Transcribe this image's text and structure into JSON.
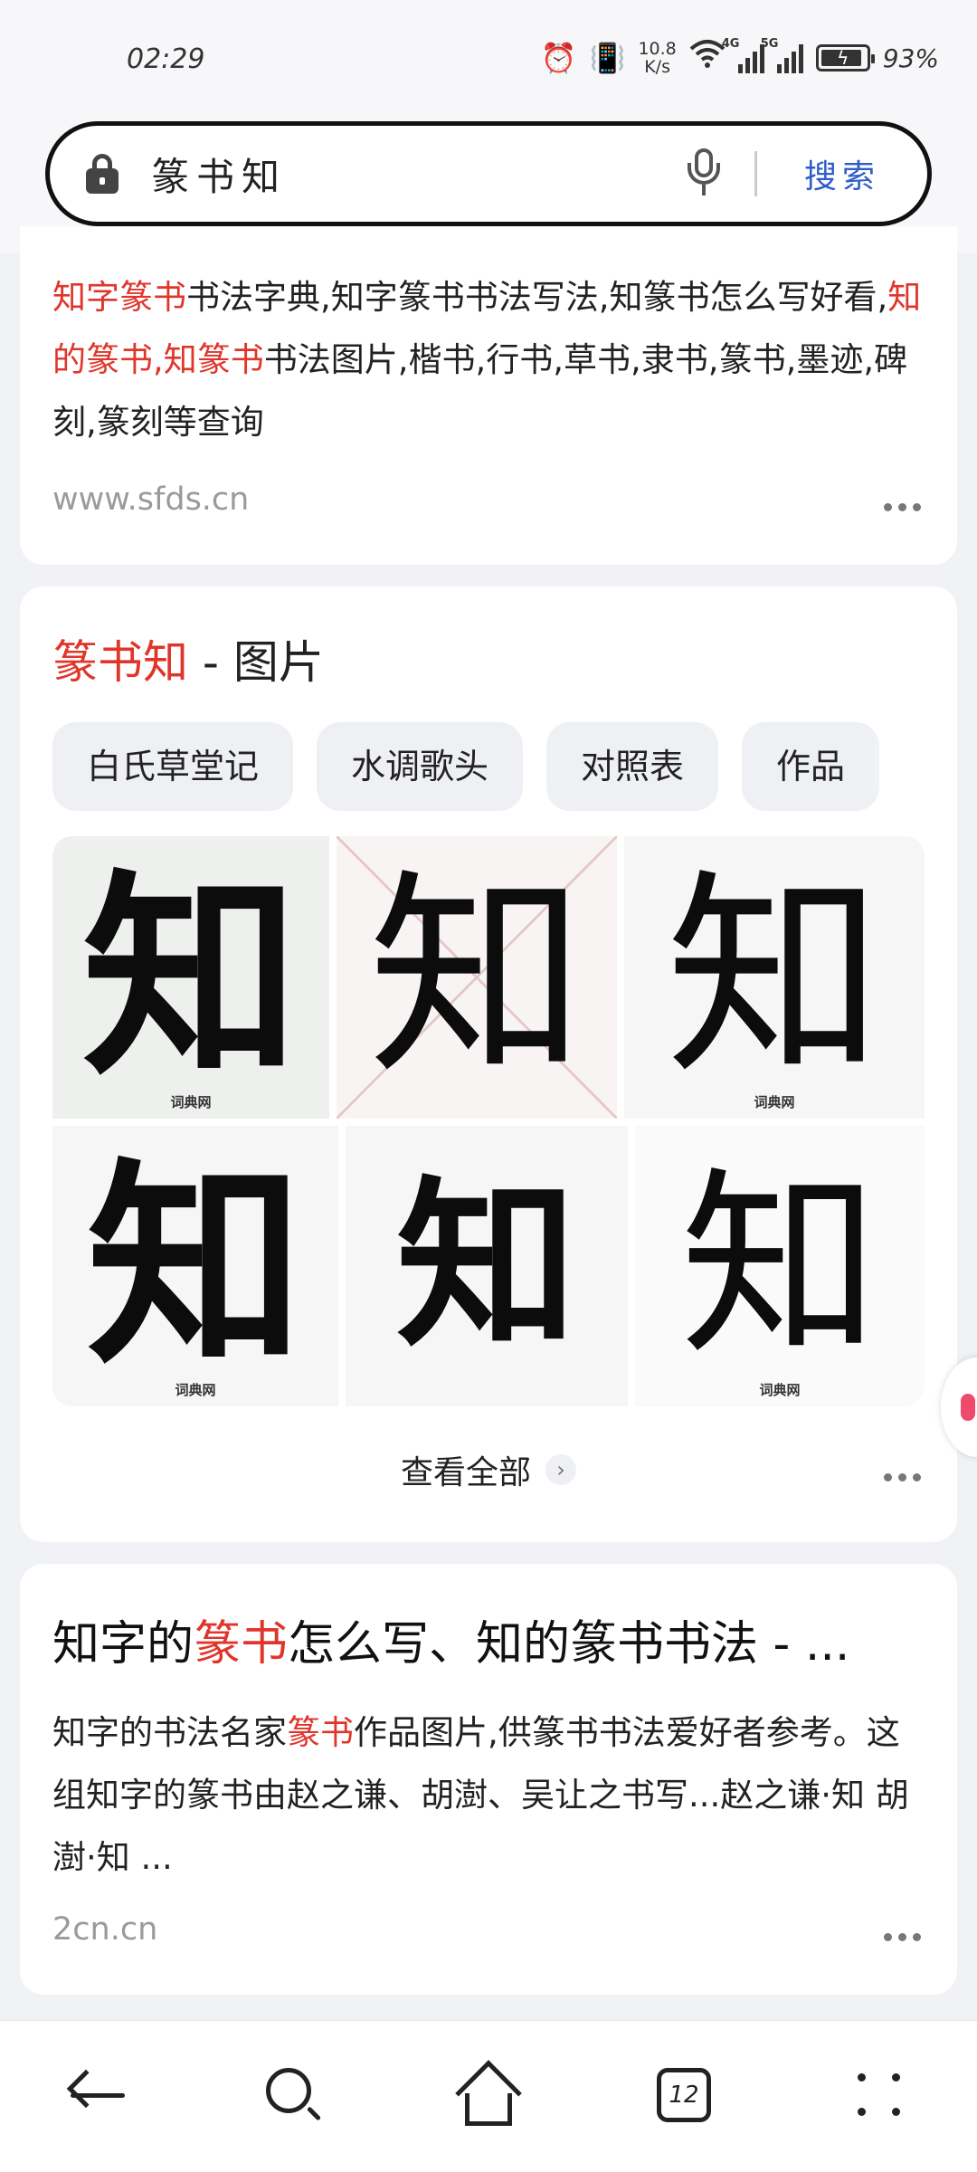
{
  "status_bar": {
    "time": "02:29",
    "net_speed_value": "10.8",
    "net_speed_unit": "K/s",
    "signal_1_tag": "4G",
    "signal_2_tag": "5G",
    "battery_percent": "93%",
    "battery_level": 0.93
  },
  "search": {
    "query": "篆书知",
    "button_label": "搜索"
  },
  "results": [
    {
      "snippet_parts": [
        {
          "text": "知字篆书",
          "hl": true
        },
        {
          "text": "书法字典,知字篆书书法写法,知篆书怎么写好看,",
          "hl": false
        },
        {
          "text": "知的篆书,知篆书",
          "hl": true
        },
        {
          "text": "书法图片,楷书,行书,草书,隶书,篆书,墨迹,碑刻,篆刻等查询",
          "hl": false
        }
      ],
      "url": "www.sfds.cn"
    }
  ],
  "image_block": {
    "title_highlight": "篆书知",
    "title_rest": " - 图片",
    "chips": [
      "白氏草堂记",
      "水调歌头",
      "对照表",
      "作品"
    ],
    "glyph": "知",
    "watermark": "词典网",
    "view_all": "查看全部"
  },
  "result2": {
    "title_a": "知字的",
    "title_hl": "篆书",
    "title_b": "怎么写、知的篆书书法 - ...",
    "snippet_a": "知字的书法名家",
    "snippet_hl": "篆书",
    "snippet_b": "作品图片,供篆书书法爱好者参考。这组知字的篆书由赵之谦、胡澍、吴让之书写...赵之谦·知 胡澍·知 ...",
    "url": "2cn.cn"
  },
  "bottom_nav": {
    "tab_count": "12"
  }
}
